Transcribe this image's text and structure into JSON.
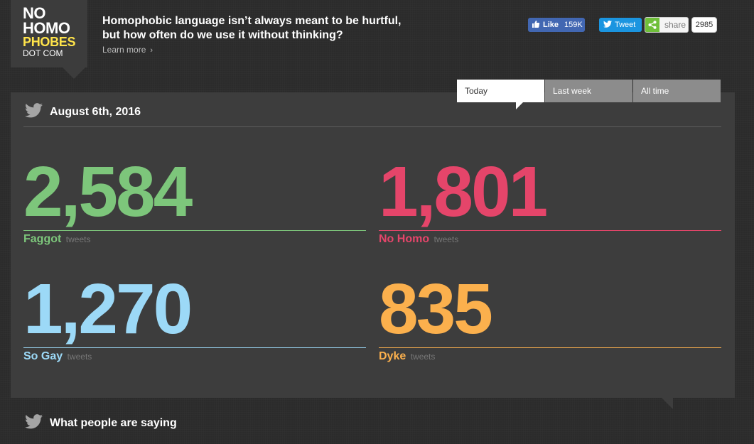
{
  "logo": {
    "line1": "NO",
    "line2": "HOMO",
    "line3": "PHOBES",
    "line4": "DOT COM"
  },
  "header": {
    "tagline": "Homophobic language isn’t always meant to be hurtful, but how often do we use it without thinking?",
    "learn_more": "Learn more"
  },
  "social": {
    "fb_like_label": "Like",
    "fb_like_count": "159K",
    "tweet_label": "Tweet",
    "share_label": "share",
    "share_count": "2985"
  },
  "tabs": [
    {
      "label": "Today",
      "active": true
    },
    {
      "label": "Last week",
      "active": false
    },
    {
      "label": "All time",
      "active": false
    }
  ],
  "panel": {
    "date": "August 6th, 2016"
  },
  "stats": [
    {
      "value": "2,584",
      "name": "Faggot",
      "unit": "tweets",
      "color": "#7dc67b"
    },
    {
      "value": "1,801",
      "name": "No Homo",
      "unit": "tweets",
      "color": "#e5456a"
    },
    {
      "value": "1,270",
      "name": "So Gay",
      "unit": "tweets",
      "color": "#9cd9f7"
    },
    {
      "value": "835",
      "name": "Dyke",
      "unit": "tweets",
      "color": "#fbb04d"
    }
  ],
  "section": {
    "title": "What people are saying"
  },
  "icons": [
    "twitter-bird-icon",
    "facebook-thumb-icon",
    "share-icon",
    "chevron-right-icon"
  ]
}
